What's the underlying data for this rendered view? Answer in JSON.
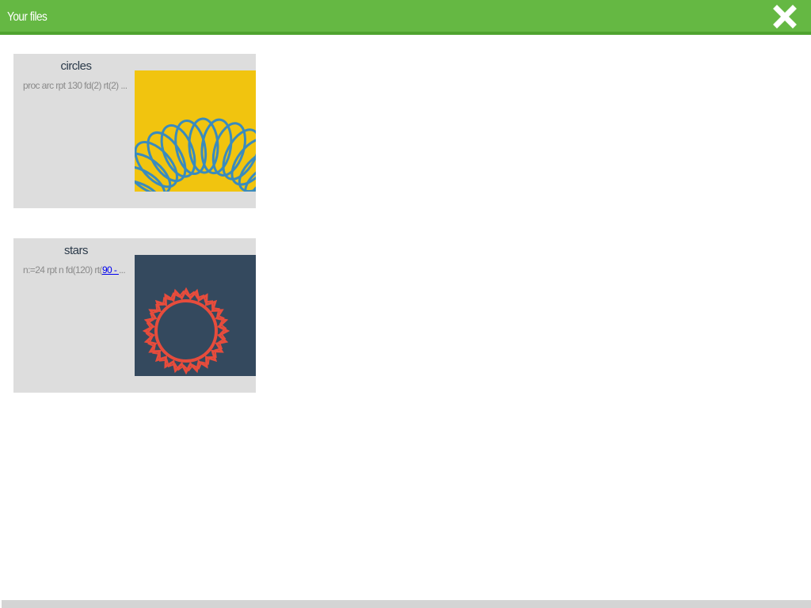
{
  "header": {
    "title": "Your files",
    "close_icon": "close-icon"
  },
  "files": [
    {
      "name": "circles",
      "snippet": "proc arc rpt 130 fd(2) rt(2) ...",
      "thumb_bg": "#f1c40f",
      "thumb_stroke": "#3a8bbd"
    },
    {
      "name": "stars",
      "snippet_prefix": "n:=24 rpt n fd(120) rt(",
      "snippet_link": "90 - ",
      "snippet_suffix": "...",
      "thumb_bg": "#34495e",
      "thumb_stroke": "#e74c3c"
    }
  ],
  "colors": {
    "header_bg": "#65b843",
    "card_bg": "#dddddd"
  }
}
